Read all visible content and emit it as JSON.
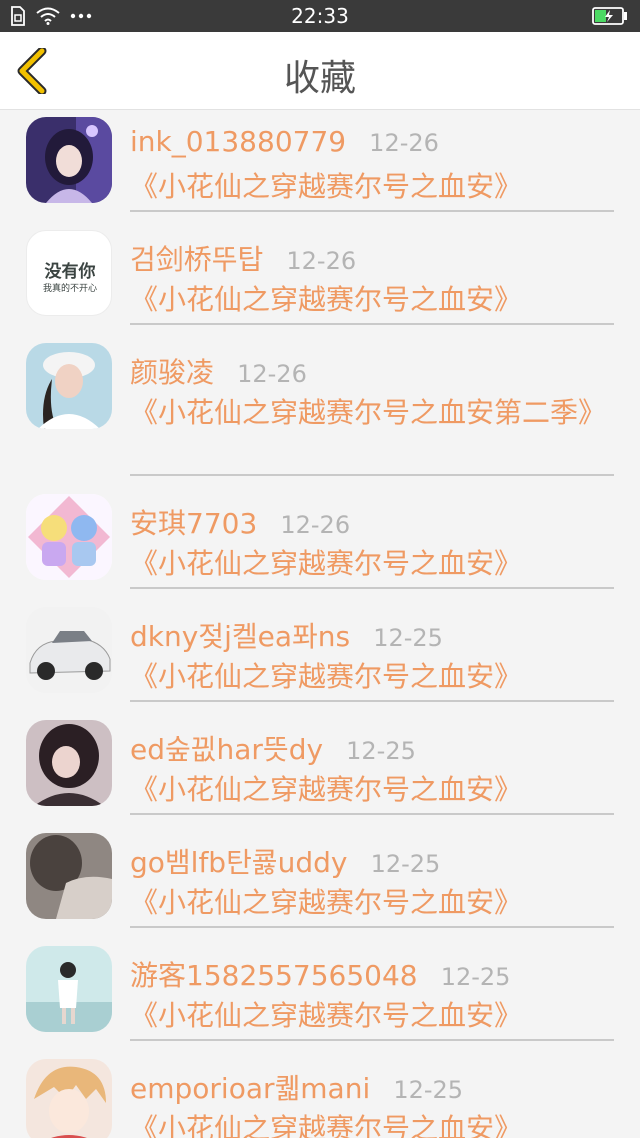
{
  "status_bar": {
    "time": "22:33",
    "battery_icon": "battery-charging-icon"
  },
  "header": {
    "title": "收藏",
    "back_icon": "chevron-left-icon"
  },
  "avatar_texts": {
    "line1": "没有你",
    "line2": "我真的不开心"
  },
  "colors": {
    "accent": "#ef9a63",
    "date": "#b4b4b4",
    "back_icon": "#f2c100"
  },
  "favorites": [
    {
      "user": "ink_013880779",
      "date": "12-26",
      "title": "《小花仙之穿越赛尔号之血安》"
    },
    {
      "user": "검剑桥뚜탑",
      "date": "12-26",
      "title": "《小花仙之穿越赛尔号之血安》"
    },
    {
      "user": "颜骏凌",
      "date": "12-26",
      "title": "《小花仙之穿越赛尔号之血安第二季》"
    },
    {
      "user": "安琪7703",
      "date": "12-26",
      "title": "《小花仙之穿越赛尔号之血安》"
    },
    {
      "user": "dkny젖j켈ea퐈ns",
      "date": "12-25",
      "title": "《小花仙之穿越赛尔号之血安》"
    },
    {
      "user": "ed숲끲har뜻dy",
      "date": "12-25",
      "title": "《小花仙之穿越赛尔号之血安》"
    },
    {
      "user": "go뱀lfb탄쿓uddy",
      "date": "12-25",
      "title": "《小花仙之穿越赛尔号之血安》"
    },
    {
      "user": "游客1582557565048",
      "date": "12-25",
      "title": "《小花仙之穿越赛尔号之血安》"
    },
    {
      "user": "emporioar퀣mani",
      "date": "12-25",
      "title": "《小花仙之穿越赛尔号之血安》"
    }
  ]
}
